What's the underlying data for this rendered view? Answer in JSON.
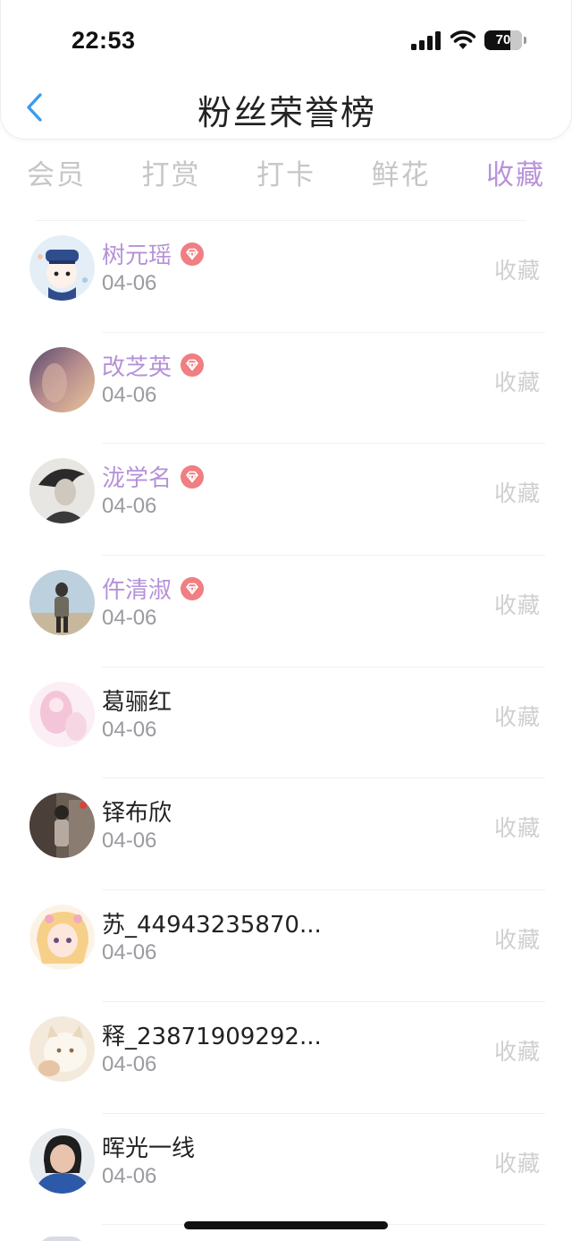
{
  "status_bar": {
    "time": "22:53",
    "battery": "70"
  },
  "header": {
    "title": "粉丝荣誉榜"
  },
  "tabs": [
    {
      "label": "会员",
      "active": false
    },
    {
      "label": "打赏",
      "active": false
    },
    {
      "label": "打卡",
      "active": false
    },
    {
      "label": "鲜花",
      "active": false
    },
    {
      "label": "收藏",
      "active": true
    }
  ],
  "list": [
    {
      "name": "树元瑶",
      "date": "04-06",
      "action": "收藏",
      "vip": true,
      "avatar": "cartoon-girl-police-avatar"
    },
    {
      "name": "改芝英",
      "date": "04-06",
      "action": "收藏",
      "vip": true,
      "avatar": "sunset-photo-avatar"
    },
    {
      "name": "泷学名",
      "date": "04-06",
      "action": "收藏",
      "vip": true,
      "avatar": "bw-portrait-avatar"
    },
    {
      "name": "仵清淑",
      "date": "04-06",
      "action": "收藏",
      "vip": true,
      "avatar": "outdoor-girl-avatar"
    },
    {
      "name": "葛骊红",
      "date": "04-06",
      "action": "收藏",
      "vip": false,
      "avatar": "pink-anime-avatar"
    },
    {
      "name": "铎布欣",
      "date": "04-06",
      "action": "收藏",
      "vip": false,
      "avatar": "street-photo-avatar"
    },
    {
      "name": "苏_44943235870...",
      "date": "04-06",
      "action": "收藏",
      "vip": false,
      "avatar": "anime-girl-avatar"
    },
    {
      "name": "释_23871909292...",
      "date": "04-06",
      "action": "收藏",
      "vip": false,
      "avatar": "cat-photo-avatar"
    },
    {
      "name": "晖光一线",
      "date": "04-06",
      "action": "收藏",
      "vip": false,
      "avatar": "woman-selfie-avatar"
    }
  ],
  "colors": {
    "accent": "#b893dc",
    "vip_name": "#b592d8",
    "vip_badge": "#f07e82",
    "back_arrow": "#3a9cf0"
  }
}
